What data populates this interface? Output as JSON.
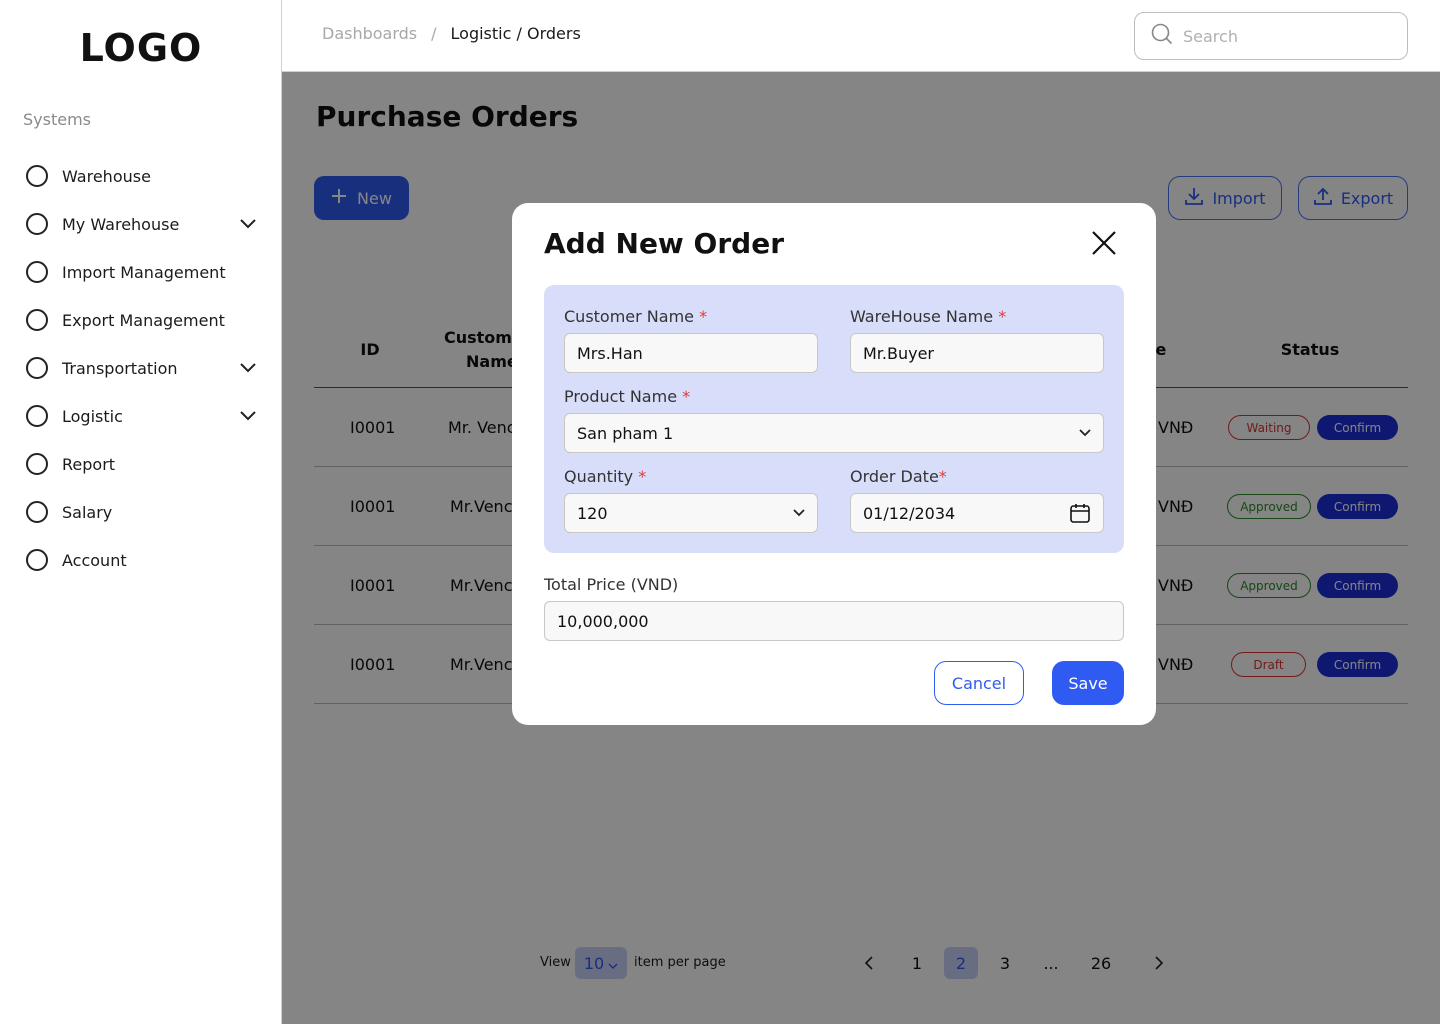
{
  "app": {
    "logo": "LOGO"
  },
  "sidebar": {
    "section_label": "Systems",
    "items": [
      {
        "label": "Warehouse",
        "has_chevron": false
      },
      {
        "label": "My Warehouse",
        "has_chevron": true
      },
      {
        "label": "Import Management",
        "has_chevron": false
      },
      {
        "label": "Export Management",
        "has_chevron": false
      },
      {
        "label": "Transportation",
        "has_chevron": true
      },
      {
        "label": "Logistic",
        "has_chevron": true
      },
      {
        "label": "Report",
        "has_chevron": false
      },
      {
        "label": "Salary",
        "has_chevron": false
      },
      {
        "label": "Account",
        "has_chevron": false
      }
    ]
  },
  "header": {
    "breadcrumb": {
      "root": "Dashboards",
      "separator": "/",
      "current": "Logistic / Orders"
    },
    "search_placeholder": "Search"
  },
  "main": {
    "title": "Purchase Orders",
    "new_button": "New",
    "import_button": "Import",
    "export_button": "Export",
    "table": {
      "headers": {
        "id": "ID",
        "customer_line1": "Custom",
        "customer_line2": "Name",
        "price_fragment": "ce",
        "status": "Status"
      },
      "rows": [
        {
          "id": "I0001",
          "customer": "Mr. Venc",
          "price": "VNĐ",
          "status": "Waiting",
          "status_type": "waiting",
          "action": "Confirm"
        },
        {
          "id": "I0001",
          "customer": "Mr.Venc",
          "price": "VNĐ",
          "status": "Approved",
          "status_type": "approved",
          "action": "Confirm"
        },
        {
          "id": "I0001",
          "customer": "Mr.Venc",
          "price": "VNĐ",
          "status": "Approved",
          "status_type": "approved",
          "action": "Confirm"
        },
        {
          "id": "I0001",
          "customer": "Mr.Venc",
          "price": "VNĐ",
          "status": "Draft",
          "status_type": "draft",
          "action": "Confirm"
        }
      ]
    },
    "pagination": {
      "view_label": "View",
      "per_page_value": "10",
      "per_page_label": "item per page",
      "pages": [
        "1",
        "2",
        "3",
        "...",
        "26"
      ],
      "active_page": "2"
    }
  },
  "modal": {
    "title": "Add New Order",
    "customer_name_label": "Customer Name",
    "customer_name_value": "Mrs.Han",
    "warehouse_name_label": "WareHouse Name",
    "warehouse_name_value": "Mr.Buyer",
    "product_name_label": "Product Name",
    "product_name_value": "San pham 1",
    "quantity_label": "Quantity",
    "quantity_value": "120",
    "order_date_label": "Order Date",
    "order_date_value": "01/12/2034",
    "total_price_label": "Total Price (VND)",
    "total_price_value": "10,000,000",
    "required_mark": "*",
    "cancel_button": "Cancel",
    "save_button": "Save"
  },
  "colors": {
    "primary": "#2f5bf2",
    "confirm": "#1d2fd6",
    "form_panel": "#d8def9",
    "required": "#e53935",
    "waiting": "#dd3333",
    "approved": "#2a8a2a"
  }
}
